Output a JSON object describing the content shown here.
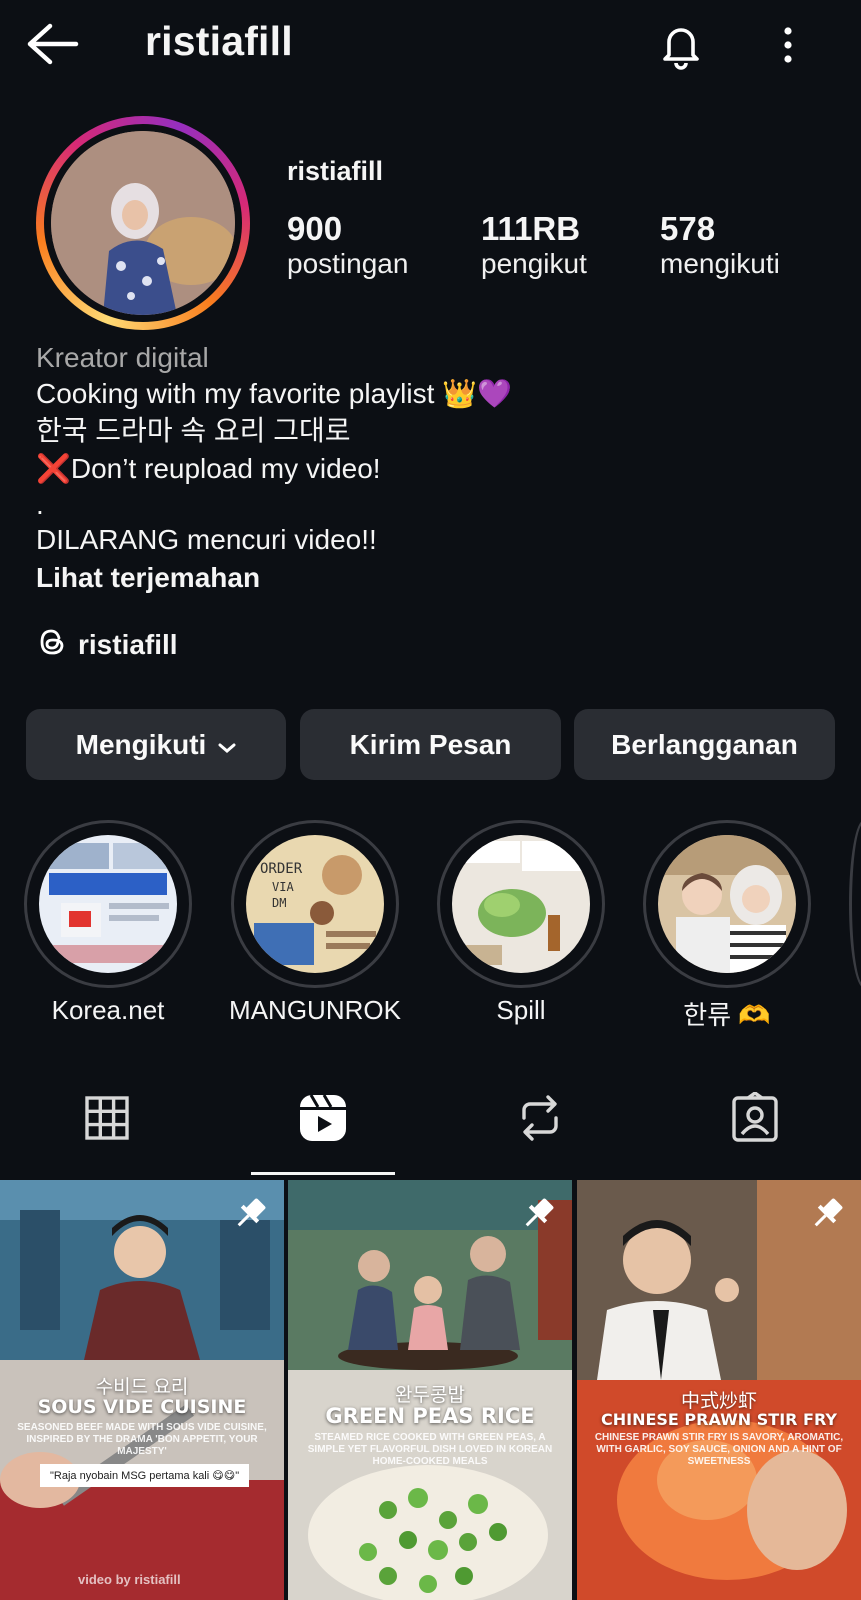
{
  "header": {
    "title": "ristiafill"
  },
  "profile": {
    "username": "ristiafill",
    "stats": [
      {
        "num": "900",
        "label": "postingan"
      },
      {
        "num": "111RB",
        "label": "pengikut"
      },
      {
        "num": "578",
        "label": "mengikuti"
      }
    ],
    "category": "Kreator digital",
    "bio_lines": [
      "Cooking with my favorite playlist 👑💜",
      "한국 드라마 속 요리 그대로",
      "❌Don’t reupload my video!",
      ".",
      "DILARANG mencuri video!!"
    ],
    "translate": "Lihat terjemahan",
    "threads_handle": "ristiafill"
  },
  "buttons": {
    "following": "Mengikuti",
    "message": "Kirim Pesan",
    "subscribe": "Berlangganan"
  },
  "highlights": [
    {
      "label": "Korea.net"
    },
    {
      "label": "MANGUNROK"
    },
    {
      "label": "Spill"
    },
    {
      "label": "한류 🫶"
    }
  ],
  "tabs": [
    "grid-icon",
    "reels-icon",
    "reposts-icon",
    "tagged-icon"
  ],
  "active_tab": "reels-icon",
  "posts": [
    {
      "kr": "수비드 요리",
      "title": "SOUS VIDE CUISINE",
      "sub": "SEASONED BEEF MADE WITH SOUS VIDE CUISINE, INSPIRED BY THE DRAMA 'BON APPETIT, YOUR MAJESTY'",
      "caption": "\"Raja nyobain MSG pertama kali 😋😋\"",
      "watermark": "video by ristiafill"
    },
    {
      "kr": "완두콩밥",
      "title": "GREEN PEAS RICE",
      "sub": "STEAMED RICE COOKED WITH GREEN PEAS, A SIMPLE YET FLAVORFUL DISH LOVED IN KOREAN HOME-COOKED MEALS"
    },
    {
      "kr": "中式炒虾",
      "title": "CHINESE PRAWN STIR FRY",
      "sub": "CHINESE PRAWN STIR FRY IS SAVORY, AROMATIC, WITH GARLIC, SOY SAUCE, ONION AND A HINT OF SWEETNESS"
    }
  ],
  "colors": {
    "background": "#0c0f14",
    "button": "#2a2d33",
    "muted": "#a8a8a8"
  }
}
